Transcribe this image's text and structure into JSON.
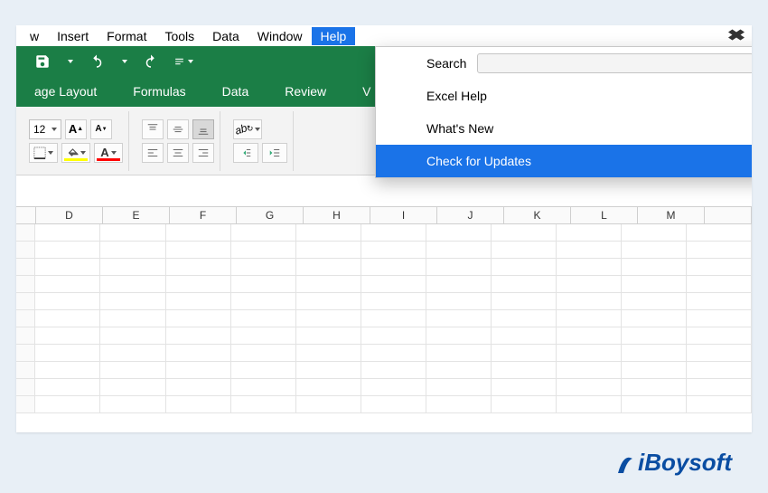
{
  "menubar": {
    "items": [
      "w",
      "Insert",
      "Format",
      "Tools",
      "Data",
      "Window",
      "Help"
    ],
    "active_index": 6
  },
  "qat": {
    "save": "save",
    "undo": "undo",
    "redo": "redo"
  },
  "ribbon_tabs": [
    "age Layout",
    "Formulas",
    "Data",
    "Review",
    "V"
  ],
  "font": {
    "size": "12",
    "grow": "A",
    "shrink": "A"
  },
  "help_menu": {
    "search_label": "Search",
    "search_placeholder": "",
    "items": [
      "Excel Help",
      "What's New",
      "Check for Updates"
    ],
    "highlight_index": 2
  },
  "columns": [
    "D",
    "E",
    "F",
    "G",
    "H",
    "I",
    "J",
    "K",
    "L",
    "M"
  ],
  "watermark": "iBoysoft"
}
